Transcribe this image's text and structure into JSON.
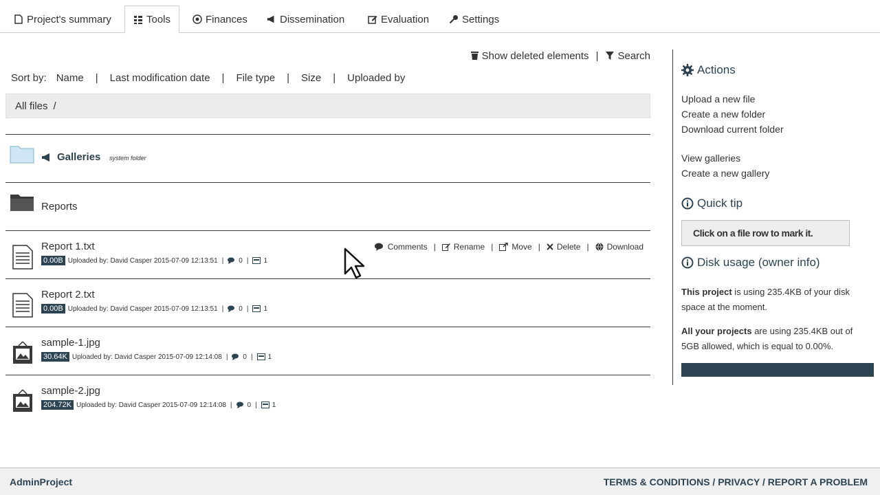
{
  "tabs": [
    {
      "label": "Project's summary",
      "icon": "document-icon"
    },
    {
      "label": "Tools",
      "icon": "grid-icon"
    },
    {
      "label": "Finances",
      "icon": "coin-icon"
    },
    {
      "label": "Dissemination",
      "icon": "megaphone-icon"
    },
    {
      "label": "Evaluation",
      "icon": "edit-icon"
    },
    {
      "label": "Settings",
      "icon": "key-icon"
    }
  ],
  "toolbar": {
    "show_deleted": "Show deleted elements",
    "search": "Search"
  },
  "sort": {
    "label": "Sort by:",
    "options": [
      "Name",
      "Last modification date",
      "File type",
      "Size",
      "Uploaded by"
    ]
  },
  "breadcrumb": {
    "root": "All files",
    "sep": "/"
  },
  "folders": [
    {
      "name": "Galleries",
      "tag": "system folder"
    },
    {
      "name": "Reports"
    }
  ],
  "files": [
    {
      "name": "Report 1.txt",
      "size": "0.00B",
      "uploaded": "Uploaded by: David Casper 2015-07-09 12:13:51",
      "comments": "0",
      "views": "1"
    },
    {
      "name": "Report 2.txt",
      "size": "0.00B",
      "uploaded": "Uploaded by: David Casper 2015-07-09 12:13:51",
      "comments": "0",
      "views": "1"
    },
    {
      "name": "sample-1.jpg",
      "size": "30.64K",
      "uploaded": "Uploaded by: David Casper 2015-07-09 12:14:08",
      "comments": "0",
      "views": "1"
    },
    {
      "name": "sample-2.jpg",
      "size": "204.72K",
      "uploaded": "Uploaded by: David Casper 2015-07-09 12:14:08",
      "comments": "0",
      "views": "1"
    }
  ],
  "row_actions": {
    "comments": "Comments",
    "rename": "Rename",
    "move": "Move",
    "delete": "Delete",
    "download": "Download"
  },
  "sidebar": {
    "actions_title": "Actions",
    "upload": "Upload a new file",
    "new_folder": "Create a new folder",
    "download_folder": "Download current folder",
    "view_galleries": "View galleries",
    "new_gallery": "Create a new gallery",
    "tip_title": "Quick tip",
    "tip_text": "Click on a file row to mark it.",
    "disk_title": "Disk usage (owner info)",
    "project_bold": "This project",
    "project_text": " is using 235.4KB of your disk space at the moment.",
    "all_bold": "All your projects",
    "all_text": " are using 235.4KB out of 5GB allowed, which is equal to 0.00%.",
    "disk_percent": 0.0
  },
  "footer": {
    "brand": "AdminProject",
    "links": "TERMS & CONDITIONS / PRIVACY / REPORT A PROBLEM"
  },
  "colors": {
    "accent": "#2c4352",
    "folder_light": "#cfe7f5",
    "folder_dark": "#3a3a3a"
  }
}
